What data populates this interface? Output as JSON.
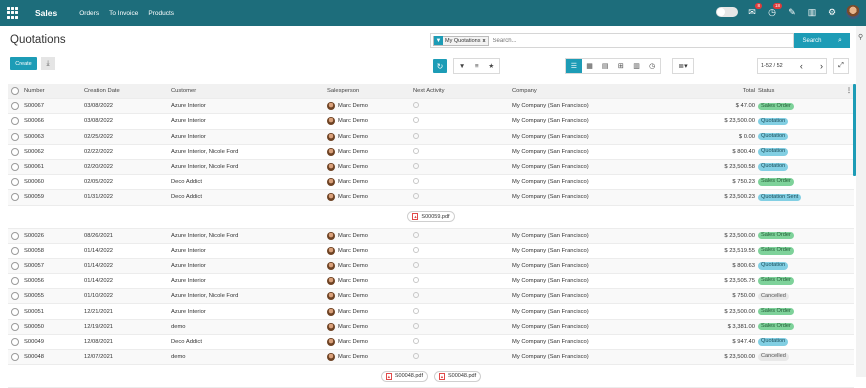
{
  "app": {
    "name": "Sales",
    "menu": [
      "Orders",
      "To Invoice",
      "Products"
    ]
  },
  "topbar_icons": [
    {
      "name": "chat-icon",
      "glyph": "✉",
      "badge": "8"
    },
    {
      "name": "activity-icon",
      "glyph": "◷",
      "badge": "18"
    },
    {
      "name": "note-icon",
      "glyph": "✎",
      "badge": ""
    },
    {
      "name": "building-icon",
      "glyph": "▥",
      "badge": ""
    },
    {
      "name": "settings-icon",
      "glyph": "⚙",
      "badge": ""
    }
  ],
  "page": {
    "title": "Quotations"
  },
  "search": {
    "facet": "My Quotations",
    "facet_remove": "x",
    "placeholder": "Search...",
    "button": "Search"
  },
  "toolbar": {
    "create": "Create",
    "pager": "1-52 / 52"
  },
  "columns": [
    "Number",
    "Creation Date",
    "Customer",
    "Salesperson",
    "Next Activity",
    "Company",
    "Total",
    "Status"
  ],
  "rows_a": [
    {
      "number": "S00067",
      "date": "03/08/2022",
      "customer": "Azure Interior",
      "salesperson": "Marc Demo",
      "company": "My Company (San Francisco)",
      "total": "$ 47.00",
      "status": "Sales Order",
      "cls": "st-so"
    },
    {
      "number": "S00066",
      "date": "03/08/2022",
      "customer": "Azure Interior",
      "salesperson": "Marc Demo",
      "company": "My Company (San Francisco)",
      "total": "$ 23,500.00",
      "status": "Quotation",
      "cls": "st-q"
    },
    {
      "number": "S00063",
      "date": "02/25/2022",
      "customer": "Azure Interior",
      "salesperson": "Marc Demo",
      "company": "My Company (San Francisco)",
      "total": "$ 0.00",
      "status": "Quotation",
      "cls": "st-q"
    },
    {
      "number": "S00062",
      "date": "02/22/2022",
      "customer": "Azure Interior, Nicole Ford",
      "salesperson": "Marc Demo",
      "company": "My Company (San Francisco)",
      "total": "$ 800.40",
      "status": "Quotation",
      "cls": "st-q"
    },
    {
      "number": "S00061",
      "date": "02/20/2022",
      "customer": "Azure Interior, Nicole Ford",
      "salesperson": "Marc Demo",
      "company": "My Company (San Francisco)",
      "total": "$ 23,500.58",
      "status": "Quotation",
      "cls": "st-q"
    },
    {
      "number": "S00060",
      "date": "02/05/2022",
      "customer": "Deco Addict",
      "salesperson": "Marc Demo",
      "company": "My Company (San Francisco)",
      "total": "$ 750.23",
      "status": "Sales Order",
      "cls": "st-so"
    },
    {
      "number": "S00059",
      "date": "01/31/2022",
      "customer": "Deco Addict",
      "salesperson": "Marc Demo",
      "company": "My Company (San Francisco)",
      "total": "$ 23,500.23",
      "status": "Quotation Sent",
      "cls": "st-qs"
    }
  ],
  "attachment_a": [
    "S00059.pdf"
  ],
  "rows_b": [
    {
      "number": "S00026",
      "date": "08/26/2021",
      "customer": "Azure Interior, Nicole Ford",
      "salesperson": "Marc Demo",
      "company": "My Company (San Francisco)",
      "total": "$ 23,500.00",
      "status": "Sales Order",
      "cls": "st-so"
    },
    {
      "number": "S00058",
      "date": "01/14/2022",
      "customer": "Azure Interior",
      "salesperson": "Marc Demo",
      "company": "My Company (San Francisco)",
      "total": "$ 23,519.55",
      "status": "Sales Order",
      "cls": "st-so"
    },
    {
      "number": "S00057",
      "date": "01/14/2022",
      "customer": "Azure Interior",
      "salesperson": "Marc Demo",
      "company": "My Company (San Francisco)",
      "total": "$ 800.63",
      "status": "Quotation",
      "cls": "st-q"
    },
    {
      "number": "S00056",
      "date": "01/14/2022",
      "customer": "Azure Interior",
      "salesperson": "Marc Demo",
      "company": "My Company (San Francisco)",
      "total": "$ 23,505.75",
      "status": "Sales Order",
      "cls": "st-so"
    },
    {
      "number": "S00055",
      "date": "01/10/2022",
      "customer": "Azure Interior, Nicole Ford",
      "salesperson": "Marc Demo",
      "company": "My Company (San Francisco)",
      "total": "$ 750.00",
      "status": "Cancelled",
      "cls": "st-c"
    },
    {
      "number": "S00051",
      "date": "12/21/2021",
      "customer": "Azure Interior",
      "salesperson": "Marc Demo",
      "company": "My Company (San Francisco)",
      "total": "$ 23,500.00",
      "status": "Sales Order",
      "cls": "st-so"
    },
    {
      "number": "S00050",
      "date": "12/19/2021",
      "customer": "demo",
      "salesperson": "Marc Demo",
      "company": "My Company (San Francisco)",
      "total": "$ 3,381.00",
      "status": "Sales Order",
      "cls": "st-so"
    },
    {
      "number": "S00049",
      "date": "12/08/2021",
      "customer": "Deco Addict",
      "salesperson": "Marc Demo",
      "company": "My Company (San Francisco)",
      "total": "$ 947.40",
      "status": "Quotation",
      "cls": "st-q"
    },
    {
      "number": "S00048",
      "date": "12/07/2021",
      "customer": "demo",
      "salesperson": "Marc Demo",
      "company": "My Company (San Francisco)",
      "total": "$ 23,500.00",
      "status": "Cancelled",
      "cls": "st-c"
    }
  ],
  "attachment_b": [
    "S00048.pdf",
    "S00048.pdf"
  ],
  "colors": {
    "topbar": "#1d6d7b",
    "accent": "#1d9cb6",
    "sales_order": "#7ed29a",
    "quotation": "#82cfe3",
    "cancelled": "#e9e9e9"
  }
}
